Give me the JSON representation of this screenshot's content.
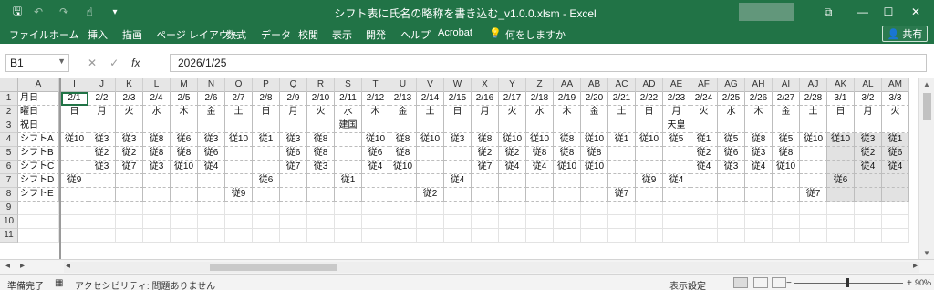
{
  "app": {
    "title": "シフト表に氏名の略称を書き込む_v1.0.0.xlsm  -  Excel",
    "qat": {
      "save": "🖫",
      "undo": "↶",
      "redo": "↷",
      "touch": "☝",
      "customize": "▾"
    },
    "window": {
      "ribbon_display": "⧉",
      "minimize": "—",
      "maximize": "☐",
      "close": "✕"
    }
  },
  "ribbon": {
    "tabs": [
      "ファイル",
      "ホーム",
      "挿入",
      "描画",
      "ページ レイアウト",
      "数式",
      "データ",
      "校閲",
      "表示",
      "開発",
      "ヘルプ",
      "Acrobat"
    ],
    "tell_me": "何をしますか",
    "tell_me_icon": "💡",
    "share": "共有",
    "share_icon": "👤"
  },
  "formula_bar": {
    "name_box": "B1",
    "cancel": "✕",
    "enter": "✓",
    "fx": "fx",
    "value": "2026/1/25"
  },
  "grid": {
    "row_numbers": [
      "1",
      "2",
      "3",
      "4",
      "5",
      "6",
      "7",
      "8",
      "9",
      "10",
      "11"
    ],
    "columns": [
      "A",
      "I",
      "J",
      "K",
      "L",
      "M",
      "N",
      "O",
      "P",
      "Q",
      "R",
      "S",
      "T",
      "U",
      "V",
      "W",
      "X",
      "Y",
      "Z",
      "AA",
      "AB",
      "AC",
      "AD",
      "AE",
      "AF",
      "AG",
      "AH",
      "AI",
      "AJ",
      "AK",
      "AL",
      "AM"
    ],
    "row_labels": [
      "月日",
      "曜日",
      "祝日",
      "シフトA",
      "シフトB",
      "シフトC",
      "シフトD",
      "シフトE"
    ],
    "dates": [
      "2/1",
      "2/2",
      "2/3",
      "2/4",
      "2/5",
      "2/6",
      "2/7",
      "2/8",
      "2/9",
      "2/10",
      "2/11",
      "2/12",
      "2/13",
      "2/14",
      "2/15",
      "2/16",
      "2/17",
      "2/18",
      "2/19",
      "2/20",
      "2/21",
      "2/22",
      "2/23",
      "2/24",
      "2/25",
      "2/26",
      "2/27",
      "2/28",
      "3/1",
      "3/2",
      "3/3"
    ],
    "weekdays": [
      "日",
      "月",
      "火",
      "水",
      "木",
      "金",
      "土",
      "日",
      "月",
      "火",
      "水",
      "木",
      "金",
      "土",
      "日",
      "月",
      "火",
      "水",
      "木",
      "金",
      "土",
      "日",
      "月",
      "火",
      "水",
      "木",
      "金",
      "土",
      "日",
      "月",
      "火"
    ],
    "holidays": [
      "",
      "",
      "",
      "",
      "",
      "",
      "",
      "",
      "",
      "",
      "建国",
      "",
      "",
      "",
      "",
      "",
      "",
      "",
      "",
      "",
      "",
      "",
      "天皇",
      "",
      "",
      "",
      "",
      "",
      "",
      "",
      ""
    ],
    "shiftA": [
      "従10",
      "従3",
      "従3",
      "従8",
      "従6",
      "従3",
      "従10",
      "従1",
      "従3",
      "従8",
      "",
      "従10",
      "従8",
      "従10",
      "従3",
      "従8",
      "従10",
      "従10",
      "従8",
      "従10",
      "従1",
      "従10",
      "従5",
      "従1",
      "従5",
      "従8",
      "従5",
      "従10",
      "従10",
      "従3",
      "従1"
    ],
    "shiftB": [
      "",
      "従2",
      "従2",
      "従8",
      "従8",
      "従6",
      "",
      "",
      "従6",
      "従8",
      "",
      "従6",
      "従8",
      "",
      "",
      "従2",
      "従2",
      "従8",
      "従8",
      "従8",
      "",
      "",
      "",
      "従2",
      "従6",
      "従3",
      "従8",
      "",
      "",
      "従2",
      "従6"
    ],
    "shiftC": [
      "",
      "従3",
      "従7",
      "従3",
      "従10",
      "従4",
      "",
      "",
      "従7",
      "従3",
      "",
      "従4",
      "従10",
      "",
      "",
      "従7",
      "従4",
      "従4",
      "従10",
      "従10",
      "",
      "",
      "",
      "従4",
      "従3",
      "従4",
      "従10",
      "",
      "",
      "従4",
      "従4"
    ],
    "shiftD": [
      "従9",
      "",
      "",
      "",
      "",
      "",
      "",
      "従6",
      "",
      "",
      "従1",
      "",
      "",
      "",
      "従4",
      "",
      "",
      "",
      "",
      "",
      "",
      "従9",
      "従4",
      "",
      "",
      "",
      "",
      "",
      "従6",
      "",
      ""
    ],
    "shiftE": [
      "",
      "",
      "",
      "",
      "",
      "",
      "従9",
      "",
      "",
      "",
      "",
      "",
      "",
      "従2",
      "",
      "",
      "",
      "",
      "",
      "",
      "従7",
      "",
      "",
      "",
      "",
      "",
      "",
      "従7",
      "",
      "",
      ""
    ]
  },
  "sheet_tabs": {
    "nav_prev": "◂",
    "nav_next": "▸",
    "scroll_left": "◂",
    "scroll_right": "▸"
  },
  "status": {
    "ready": "準備完了",
    "macro_icon": "▦",
    "accessibility": "アクセシビリティ: 問題ありません",
    "display_settings": "表示設定",
    "zoom_minus": "−",
    "zoom_plus": "+",
    "zoom": "90%"
  }
}
